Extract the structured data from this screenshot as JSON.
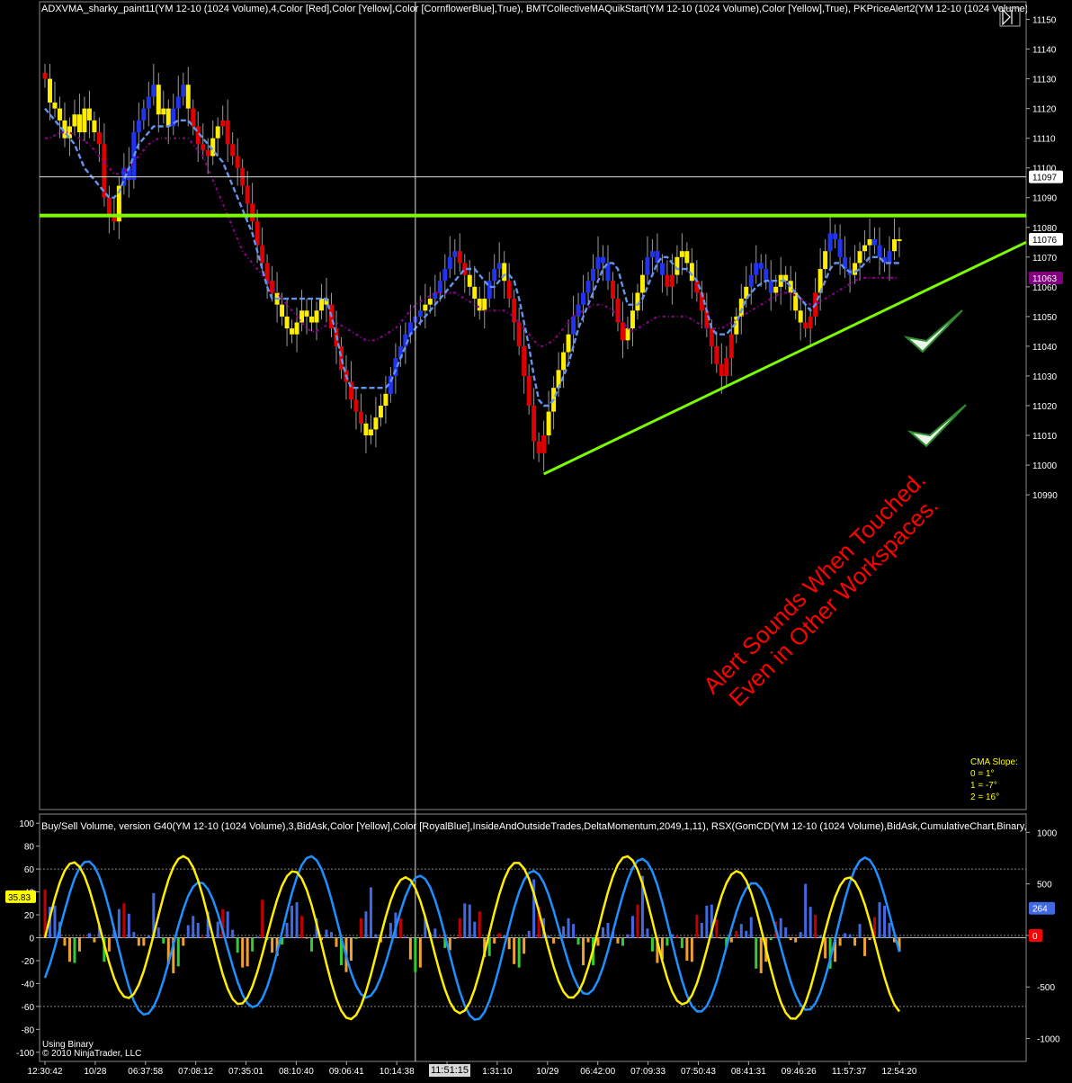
{
  "chart_data": [
    {
      "type": "candlestick",
      "title": "ADXVMA_sharky_paint11(YM 12-10 (1024 Volume),4,Color [Red],Color [Yellow],Color [CornflowerBlue],True), BMTCollectiveMAQuikStart(YM 12-10 (1024 Volume),Color [Yellow],True), PKPriceAlert2(YM 12-10 (1024 Volume)",
      "ylim": [
        10885,
        11155
      ],
      "yticks": [
        "11150",
        "11140",
        "11130",
        "11120",
        "11110",
        "11100",
        "11090",
        "11080",
        "11070",
        "11060",
        "11050",
        "11040",
        "11030",
        "11020",
        "11010",
        "11000",
        "10990"
      ],
      "ytick_values": [
        11150,
        11140,
        11130,
        11120,
        11110,
        11100,
        11090,
        11080,
        11070,
        11060,
        11050,
        11040,
        11030,
        11020,
        11010,
        11000,
        10990
      ],
      "price_badges": [
        {
          "label": "11097",
          "value": 11097,
          "color": "#ffffff",
          "text_color": "#000000"
        },
        {
          "label": "11076",
          "value": 11076,
          "color": "#ffffff",
          "text_color": "#000000"
        },
        {
          "label": "11063",
          "value": 11063,
          "color": "#800080",
          "text_color": "#ffffff"
        }
      ],
      "alert_line": {
        "value": 11084,
        "color": "#7cfc00"
      },
      "trend_line": {
        "from": {
          "bar": 101,
          "value": 10997
        },
        "to": {
          "bar": 186,
          "value": 11075
        },
        "color": "#7cfc00"
      },
      "crosshair": {
        "value": 11097,
        "bar": 75
      },
      "bars_close": [
        11130,
        11122,
        11120,
        11116,
        11110,
        11114,
        11118,
        11112,
        11120,
        11116,
        11112,
        11108,
        11090,
        11084,
        11082,
        11094,
        11100,
        11096,
        11112,
        11116,
        11120,
        11124,
        11128,
        11118,
        11120,
        11114,
        11120,
        11124,
        11128,
        11120,
        11114,
        11108,
        11106,
        11104,
        11110,
        11114,
        11116,
        11108,
        11104,
        11100,
        11094,
        11088,
        11082,
        11074,
        11068,
        11062,
        11058,
        11054,
        11050,
        11046,
        11044,
        11048,
        11052,
        11050,
        11048,
        11052,
        11056,
        11054,
        11046,
        11040,
        11032,
        11028,
        11022,
        11018,
        11014,
        11010,
        11012,
        11016,
        11020,
        11024,
        11030,
        11036,
        11040,
        11044,
        11048,
        11050,
        11052,
        11054,
        11056,
        11058,
        11062,
        11066,
        11070,
        11072,
        11068,
        11064,
        11060,
        11056,
        11052,
        11056,
        11062,
        11066,
        11068,
        11062,
        11056,
        11048,
        11040,
        11030,
        11020,
        11008,
        11004,
        11010,
        11018,
        11026,
        11032,
        11038,
        11044,
        11050,
        11054,
        11058,
        11062,
        11066,
        11070,
        11068,
        11062,
        11056,
        11048,
        11042,
        11046,
        11052,
        11058,
        11064,
        11070,
        11072,
        11068,
        11064,
        11060,
        11064,
        11070,
        11072,
        11068,
        11062,
        11058,
        11052,
        11046,
        11040,
        11034,
        11030,
        11036,
        11044,
        11050,
        11056,
        11060,
        11064,
        11068,
        11066,
        11062,
        11058,
        11060,
        11064,
        11062,
        11058,
        11052,
        11048,
        11046,
        11050,
        11058,
        11066,
        11072,
        11078,
        11076,
        11070,
        11066,
        11064,
        11068,
        11072,
        11074,
        11076,
        11074,
        11070,
        11068,
        11072,
        11076,
        11076
      ],
      "bars_color": [
        "red",
        "yellow",
        "yellow",
        "yellow",
        "yellow",
        "yellow",
        "yellow",
        "yellow",
        "yellow",
        "yellow",
        "yellow",
        "red",
        "red",
        "red",
        "red",
        "yellow",
        "blue",
        "blue",
        "blue",
        "blue",
        "blue",
        "blue",
        "blue",
        "yellow",
        "yellow",
        "yellow",
        "blue",
        "blue",
        "blue",
        "yellow",
        "red",
        "red",
        "red",
        "red",
        "yellow",
        "yellow",
        "red",
        "red",
        "red",
        "red",
        "red",
        "red",
        "red",
        "red",
        "red",
        "red",
        "red",
        "yellow",
        "yellow",
        "yellow",
        "yellow",
        "yellow",
        "yellow",
        "yellow",
        "yellow",
        "yellow",
        "yellow",
        "yellow",
        "red",
        "red",
        "red",
        "red",
        "red",
        "red",
        "red",
        "yellow",
        "yellow",
        "yellow",
        "yellow",
        "yellow",
        "blue",
        "blue",
        "blue",
        "blue",
        "blue",
        "blue",
        "blue",
        "yellow",
        "yellow",
        "blue",
        "blue",
        "blue",
        "blue",
        "blue",
        "red",
        "red",
        "yellow",
        "yellow",
        "yellow",
        "yellow",
        "blue",
        "blue",
        "blue",
        "yellow",
        "red",
        "red",
        "red",
        "red",
        "red",
        "red",
        "red",
        "red",
        "yellow",
        "yellow",
        "yellow",
        "yellow",
        "yellow",
        "blue",
        "blue",
        "blue",
        "blue",
        "blue",
        "blue",
        "blue",
        "blue",
        "red",
        "red",
        "red",
        "yellow",
        "yellow",
        "yellow",
        "yellow",
        "blue",
        "blue",
        "blue",
        "blue",
        "red",
        "red",
        "yellow",
        "yellow",
        "yellow",
        "yellow",
        "red",
        "red",
        "red",
        "red",
        "red",
        "red",
        "red",
        "red",
        "yellow",
        "yellow",
        "yellow",
        "blue",
        "blue",
        "blue",
        "blue",
        "blue",
        "yellow",
        "yellow",
        "yellow",
        "yellow",
        "yellow",
        "yellow",
        "red",
        "red",
        "red",
        "yellow",
        "yellow",
        "blue",
        "blue",
        "blue",
        "blue",
        "blue",
        "yellow",
        "yellow",
        "yellow",
        "yellow",
        "blue",
        "blue",
        "blue",
        "blue",
        "yellow",
        "yellow",
        "yellow",
        "yellow",
        "blue",
        "yellow",
        "yellow",
        "yellow"
      ],
      "adxvma_line": [
        11120,
        11118,
        11116,
        11114,
        11112,
        11110,
        11108,
        11104,
        11100,
        11098,
        11096,
        11094,
        11092,
        11090,
        11090,
        11092,
        11096,
        11100,
        11104,
        11108,
        11110,
        11112,
        11114,
        11114,
        11114,
        11114,
        11115,
        11116,
        11116,
        11116,
        11114,
        11112,
        11110,
        11108,
        11106,
        11104,
        11102,
        11098,
        11094,
        11090,
        11086,
        11082,
        11078,
        11072,
        11066,
        11060,
        11056,
        11056,
        11056,
        11056,
        11056,
        11056,
        11056,
        11056,
        11056,
        11056,
        11056,
        11056,
        11050,
        11044,
        11036,
        11030,
        11026,
        11026,
        11026,
        11026,
        11026,
        11026,
        11026,
        11026,
        11028,
        11032,
        11036,
        11040,
        11044,
        11046,
        11048,
        11050,
        11052,
        11054,
        11056,
        11058,
        11060,
        11062,
        11064,
        11066,
        11066,
        11066,
        11064,
        11062,
        11060,
        11060,
        11062,
        11064,
        11064,
        11062,
        11056,
        11048,
        11040,
        11030,
        11022,
        11020,
        11020,
        11022,
        11026,
        11030,
        11034,
        11040,
        11046,
        11050,
        11054,
        11058,
        11062,
        11066,
        11068,
        11068,
        11066,
        11060,
        11054,
        11054,
        11054,
        11056,
        11060,
        11064,
        11068,
        11070,
        11070,
        11068,
        11066,
        11066,
        11066,
        11064,
        11062,
        11058,
        11052,
        11046,
        11044,
        11044,
        11044,
        11046,
        11048,
        11052,
        11056,
        11058,
        11060,
        11061,
        11062,
        11062,
        11062,
        11062,
        11062,
        11060,
        11058,
        11056,
        11054,
        11052,
        11054,
        11058,
        11062,
        11066,
        11068,
        11068,
        11066,
        11065,
        11065,
        11066,
        11068,
        11070,
        11070,
        11070,
        11068,
        11068,
        11068,
        11068
      ],
      "collective_ma": [
        11110,
        11110,
        11111,
        11112,
        11112,
        11112,
        11111,
        11110,
        11109,
        11108,
        11106,
        11104,
        11102,
        11100,
        11098,
        11098,
        11099,
        11100,
        11102,
        11104,
        11106,
        11108,
        11109,
        11110,
        11110,
        11110,
        11110,
        11110,
        11110,
        11110,
        11108,
        11106,
        11104,
        11100,
        11096,
        11092,
        11088,
        11084,
        11080,
        11076,
        11072,
        11070,
        11068,
        11066,
        11064,
        11062,
        11060,
        11058,
        11056,
        11054,
        11052,
        11050,
        11048,
        11046,
        11045,
        11045,
        11046,
        11047,
        11048,
        11048,
        11047,
        11046,
        11045,
        11044,
        11043,
        11042,
        11042,
        11042,
        11043,
        11044,
        11045,
        11046,
        11048,
        11050,
        11052,
        11054,
        11055,
        11056,
        11057,
        11058,
        11058,
        11058,
        11058,
        11058,
        11057,
        11056,
        11055,
        11054,
        11053,
        11052,
        11052,
        11052,
        11052,
        11052,
        11051,
        11050,
        11048,
        11046,
        11044,
        11042,
        11040,
        11040,
        11041,
        11042,
        11044,
        11046,
        11048,
        11050,
        11051,
        11052,
        11053,
        11054,
        11054,
        11054,
        11053,
        11052,
        11050,
        11048,
        11046,
        11045,
        11046,
        11047,
        11048,
        11049,
        11050,
        11050,
        11050,
        11050,
        11050,
        11050,
        11050,
        11049,
        11048,
        11047,
        11046,
        11046,
        11046,
        11046,
        11047,
        11048,
        11049,
        11050,
        11051,
        11052,
        11053,
        11054,
        11055,
        11056,
        11057,
        11058,
        11058,
        11058,
        11057,
        11056,
        11055,
        11054,
        11054,
        11055,
        11056,
        11057,
        11058,
        11059,
        11060,
        11061,
        11062,
        11063,
        11063,
        11063,
        11063,
        11063,
        11063,
        11063,
        11063,
        11063
      ],
      "annotation": "Alert Sounds When Touched.\nEven in Other Workspaces.",
      "cma_slope": {
        "title": "CMA Slope:",
        "lines": [
          "0 = 1°",
          "1 = -7°",
          "2 = 16°"
        ]
      }
    },
    {
      "type": "bar+line",
      "title": "Buy/Sell Volume, version G40(YM 12-10 (1024 Volume),3,BidAsk,Color [Yellow],Color [RoyalBlue],InsideAndOutsideTrades,DeltaMomentum,2049,1,11), RSX(GomCD(YM 12-10 (1024 Volume),BidAsk,CumulativeChart,Binary,N",
      "left_axis": {
        "ticks": [
          "100",
          "80",
          "60",
          "40",
          "20",
          "0",
          "-20",
          "-40",
          "-60",
          "-80",
          "-100"
        ],
        "values": [
          100,
          80,
          60,
          40,
          20,
          0,
          -20,
          -40,
          -60,
          -80,
          -100
        ],
        "ylim": [
          -108,
          108
        ]
      },
      "right_axis": {
        "ticks": [
          "1000",
          "500",
          "0",
          "-500",
          "-1000"
        ],
        "values": [
          1000,
          500,
          0,
          -500,
          -1000
        ]
      },
      "left_badge": {
        "label": "35.83",
        "value": 35.83
      },
      "right_badges": [
        {
          "label": "264",
          "value": 264,
          "color": "#4169e1"
        },
        {
          "label": "0",
          "value": 0,
          "color": "#ff0000"
        }
      ],
      "dotted_lines": [
        60,
        -60,
        2
      ],
      "xlabels": [
        "12:30:42",
        "10/28",
        "06:37:58",
        "07:08:12",
        "07:35:01",
        "08:10:40",
        "09:06:41",
        "10:14:38",
        "11:51:15",
        "1:31:10",
        "10/29",
        "06:42:00",
        "07:09:33",
        "07:50:43",
        "08:41:31",
        "09:46:26",
        "11:57:37",
        "12:54:20"
      ],
      "time_tag": "11:51:15",
      "footer": [
        "Using Binary",
        "© 2010 NinjaTrader, LLC"
      ]
    }
  ]
}
